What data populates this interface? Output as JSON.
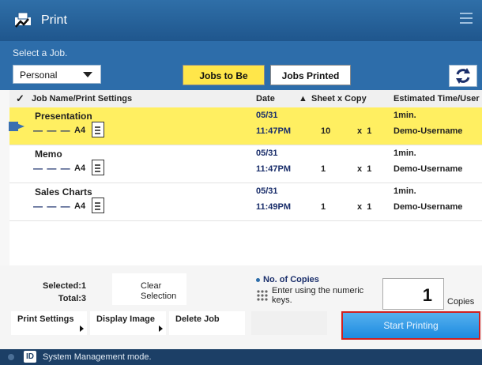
{
  "titlebar": {
    "title": "Print"
  },
  "prompt": "Select a Job.",
  "filter": {
    "selected": "Personal"
  },
  "tabs": {
    "active": "Jobs to Be Printed",
    "inactive": "Jobs Printed"
  },
  "table": {
    "headers": {
      "name": "Job Name/Print Settings",
      "date": "Date",
      "sheets": "Sheet x Copy",
      "est": "Estimated Time/User Name"
    },
    "rows": [
      {
        "name": "Presentation",
        "dashes": "— — —",
        "paper": "A4",
        "date": "05/31",
        "time": "11:47PM",
        "sheets": "10",
        "x": "x",
        "copies": "1",
        "est": "1min.",
        "user": "Demo-Username",
        "selected": true
      },
      {
        "name": "Memo",
        "dashes": "— — —",
        "paper": "A4",
        "date": "05/31",
        "time": "11:47PM",
        "sheets": "1",
        "x": "x",
        "copies": "1",
        "est": "1min.",
        "user": "Demo-Username",
        "selected": false
      },
      {
        "name": "Sales Charts",
        "dashes": "— — —",
        "paper": "A4",
        "date": "05/31",
        "time": "11:49PM",
        "sheets": "1",
        "x": "x",
        "copies": "1",
        "est": "1min.",
        "user": "Demo-Username",
        "selected": false
      }
    ]
  },
  "selection": {
    "selected_label": "Selected:",
    "selected_value": "1",
    "total_label": "Total:",
    "total_value": "3",
    "clear_label": "Clear Selection"
  },
  "copies": {
    "title": "No. of Copies",
    "hint": "Enter using the numeric keys.",
    "value": "1",
    "unit": "Copies"
  },
  "actions": {
    "print_settings": "Print Settings",
    "display_image": "Display Image",
    "delete_job": "Delete Job",
    "start": "Start Printing"
  },
  "status": {
    "message": "System Management mode."
  },
  "colors": {
    "title_blue": "#2f6fa8",
    "selected_row": "#ffef61",
    "active_tab": "#ffe64a",
    "start_button": "#1d8be0",
    "status_bar": "#1c3f66"
  }
}
